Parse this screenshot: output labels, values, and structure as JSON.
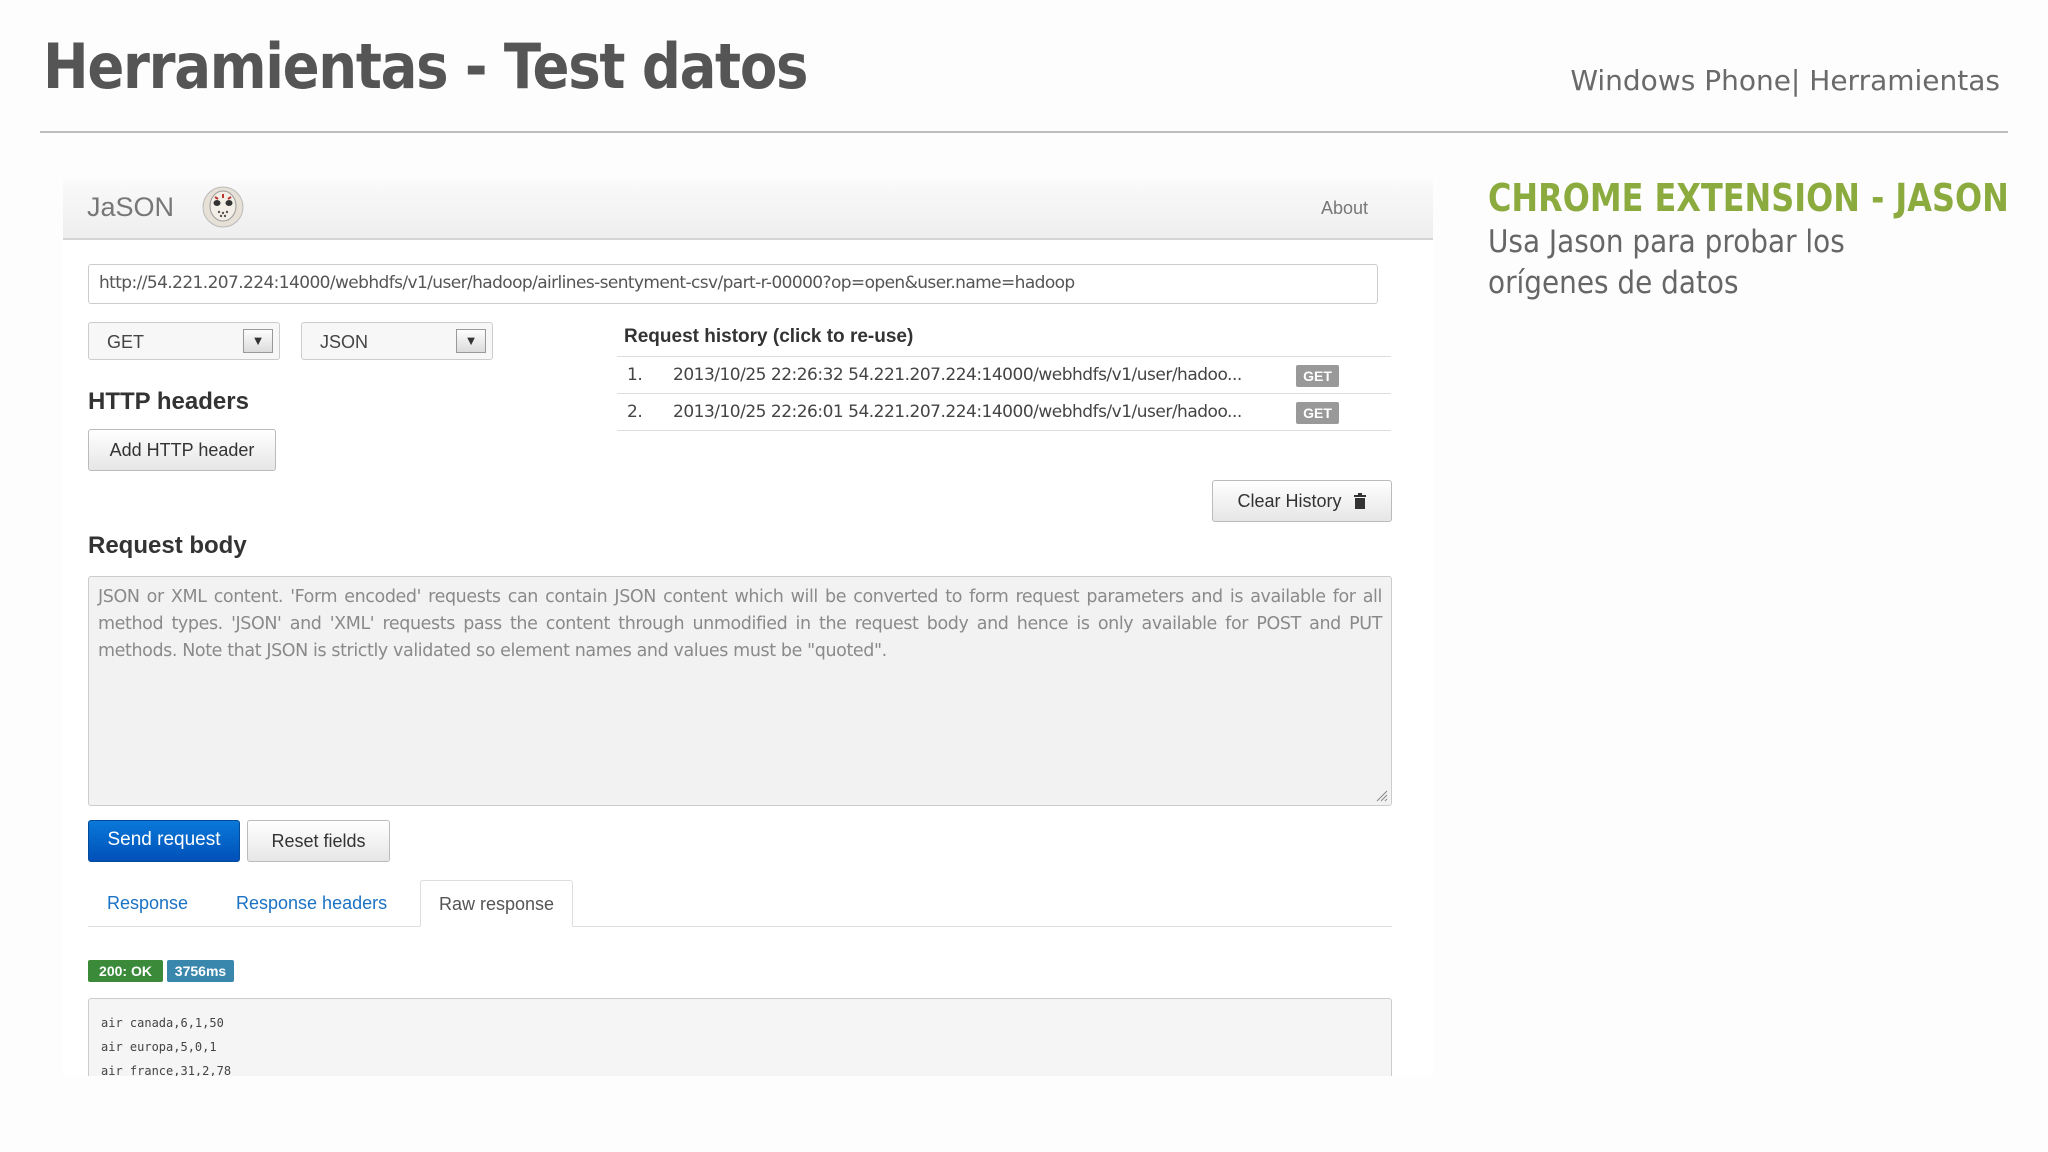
{
  "slide": {
    "title": "Herramientas - Test datos",
    "breadcrumb": "Windows Phone| Herramientas",
    "side_heading": "CHROME EXTENSION - JASON",
    "side_text": "Usa Jason para probar los orígenes de datos"
  },
  "app": {
    "brand": "JaSON",
    "about_link": "About",
    "url": "http://54.221.207.224:14000/webhdfs/v1/user/hadoop/airlines-sentyment-csv/part-r-00000?op=open&user.name=hadoop",
    "method_select": "GET",
    "format_select": "JSON",
    "headers_title": "HTTP headers",
    "add_header_button": "Add HTTP header",
    "history_title": "Request history (click to re-use)",
    "history": [
      {
        "num": "1.",
        "text": "2013/10/25 22:26:32 54.221.207.224:14000/webhdfs/v1/user/hadoo...",
        "method": "GET"
      },
      {
        "num": "2.",
        "text": "2013/10/25 22:26:01 54.221.207.224:14000/webhdfs/v1/user/hadoo...",
        "method": "GET"
      }
    ],
    "clear_history_button": "Clear History",
    "body_title": "Request body",
    "body_placeholder": "JSON or XML content. 'Form encoded' requests can contain JSON content which will be converted to form request parameters and is available for all method types. 'JSON' and 'XML' requests pass the content through unmodified in the request body and hence is only available for POST and PUT methods. Note that JSON is strictly validated so element names and values must be \"quoted\".",
    "send_button": "Send request",
    "reset_button": "Reset fields",
    "tabs": [
      "Response",
      "Response headers",
      "Raw response"
    ],
    "active_tab": "Raw response",
    "status_badge": "200: OK",
    "time_badge": "3756ms",
    "raw_lines": [
      "air canada,6,1,50",
      "air europa,5,0,1",
      "air france,31,2,78"
    ],
    "colors": {
      "status_green": "#3a8a3a",
      "time_blue": "#3a87ad",
      "get_badge": "#999999",
      "send_blue": "#0062c9",
      "accent_green": "#8cab3f"
    }
  }
}
